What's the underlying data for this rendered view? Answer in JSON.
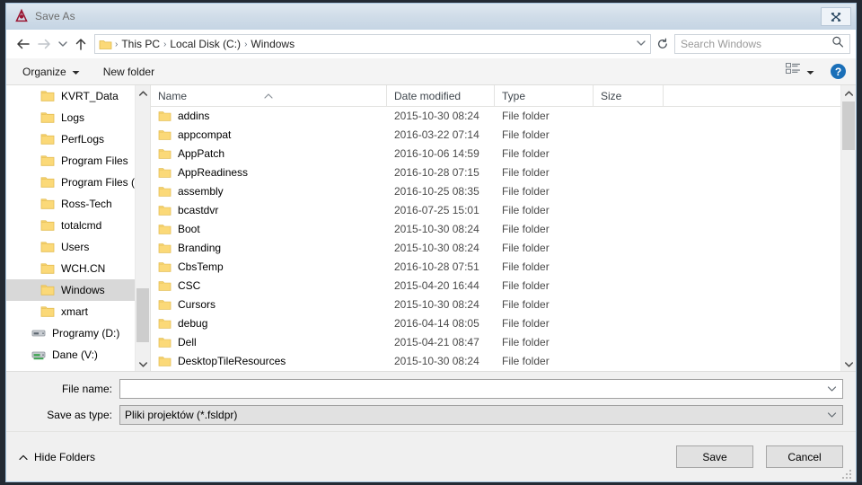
{
  "window": {
    "title": "Save As",
    "title_icon": "app-logo-icon",
    "close_label": "close-icon"
  },
  "nav": {
    "back_icon": "back-arrow-icon",
    "forward_icon": "forward-arrow-icon",
    "recent_icon": "chevron-down-icon",
    "up_icon": "up-arrow-icon",
    "breadcrumb_folder_icon": "folder-icon",
    "breadcrumbs": [
      "This PC",
      "Local Disk (C:)",
      "Windows"
    ],
    "separator": "›",
    "address_dropdown_icon": "chevron-down-icon",
    "refresh_icon": "refresh-icon"
  },
  "search": {
    "placeholder": "Search Windows",
    "icon": "search-icon"
  },
  "toolbar": {
    "organize_label": "Organize",
    "organize_caret": "caret-down-icon",
    "new_folder_label": "New folder",
    "view_icon": "list-view-icon",
    "view_caret": "caret-down-icon",
    "help_label": "?",
    "help_icon": "help-icon"
  },
  "tree": {
    "items": [
      {
        "label": "KVRT_Data",
        "icon": "folder-icon",
        "type": "folder",
        "selected": false
      },
      {
        "label": "Logs",
        "icon": "folder-icon",
        "type": "folder",
        "selected": false
      },
      {
        "label": "PerfLogs",
        "icon": "folder-icon",
        "type": "folder",
        "selected": false
      },
      {
        "label": "Program Files",
        "icon": "folder-icon",
        "type": "folder",
        "selected": false
      },
      {
        "label": "Program Files (",
        "icon": "folder-icon",
        "type": "folder",
        "selected": false
      },
      {
        "label": "Ross-Tech",
        "icon": "folder-icon",
        "type": "folder",
        "selected": false
      },
      {
        "label": "totalcmd",
        "icon": "folder-icon",
        "type": "folder",
        "selected": false
      },
      {
        "label": "Users",
        "icon": "folder-icon",
        "type": "folder",
        "selected": false
      },
      {
        "label": "WCH.CN",
        "icon": "folder-icon",
        "type": "folder",
        "selected": false
      },
      {
        "label": "Windows",
        "icon": "folder-icon",
        "type": "folder",
        "selected": true
      },
      {
        "label": "xmart",
        "icon": "folder-icon",
        "type": "folder",
        "selected": false
      },
      {
        "label": "Programy (D:)",
        "icon": "drive-icon",
        "type": "drive",
        "selected": false
      },
      {
        "label": "Dane (V:)",
        "icon": "network-drive-icon",
        "type": "netdrive",
        "selected": false
      }
    ],
    "scroll_up_icon": "chevron-up-icon",
    "scroll_down_icon": "chevron-down-icon"
  },
  "filelist": {
    "columns": [
      "Name",
      "Date modified",
      "Type",
      "Size"
    ],
    "sort_column": "Name",
    "sort_direction": "ascending",
    "sort_icon": "sort-ascending-caret-icon",
    "rows": [
      {
        "name": "addins",
        "date": "2015-10-30 08:24",
        "type": "File folder",
        "size": ""
      },
      {
        "name": "appcompat",
        "date": "2016-03-22 07:14",
        "type": "File folder",
        "size": ""
      },
      {
        "name": "AppPatch",
        "date": "2016-10-06 14:59",
        "type": "File folder",
        "size": ""
      },
      {
        "name": "AppReadiness",
        "date": "2016-10-28 07:15",
        "type": "File folder",
        "size": ""
      },
      {
        "name": "assembly",
        "date": "2016-10-25 08:35",
        "type": "File folder",
        "size": ""
      },
      {
        "name": "bcastdvr",
        "date": "2016-07-25 15:01",
        "type": "File folder",
        "size": ""
      },
      {
        "name": "Boot",
        "date": "2015-10-30 08:24",
        "type": "File folder",
        "size": ""
      },
      {
        "name": "Branding",
        "date": "2015-10-30 08:24",
        "type": "File folder",
        "size": ""
      },
      {
        "name": "CbsTemp",
        "date": "2016-10-28 07:51",
        "type": "File folder",
        "size": ""
      },
      {
        "name": "CSC",
        "date": "2015-04-20 16:44",
        "type": "File folder",
        "size": ""
      },
      {
        "name": "Cursors",
        "date": "2015-10-30 08:24",
        "type": "File folder",
        "size": ""
      },
      {
        "name": "debug",
        "date": "2016-04-14 08:05",
        "type": "File folder",
        "size": ""
      },
      {
        "name": "Dell",
        "date": "2015-04-21 08:47",
        "type": "File folder",
        "size": ""
      },
      {
        "name": "DesktopTileResources",
        "date": "2015-10-30 08:24",
        "type": "File folder",
        "size": ""
      }
    ],
    "row_icon": "folder-icon",
    "scroll_up_icon": "chevron-up-icon",
    "scroll_down_icon": "chevron-down-icon"
  },
  "form": {
    "filename_label": "File name:",
    "filename_value": "",
    "filename_dropdown_icon": "chevron-down-icon",
    "savetype_label": "Save as type:",
    "savetype_value": "Pliki projektów (*.fsldpr)",
    "savetype_dropdown_icon": "chevron-down-icon"
  },
  "footer": {
    "hide_folders_label": "Hide Folders",
    "hide_folders_icon": "chevron-up-icon",
    "save_label": "Save",
    "cancel_label": "Cancel",
    "resize_grip_icon": "resize-grip-icon"
  },
  "colors": {
    "accent": "#1a6fb8",
    "titlebar": "#cfdce8",
    "dialog_bg": "#f0f0f0",
    "selection": "#d8d8d8",
    "folder_yellow": "#fbd978",
    "app_logo": "#9b1733"
  }
}
